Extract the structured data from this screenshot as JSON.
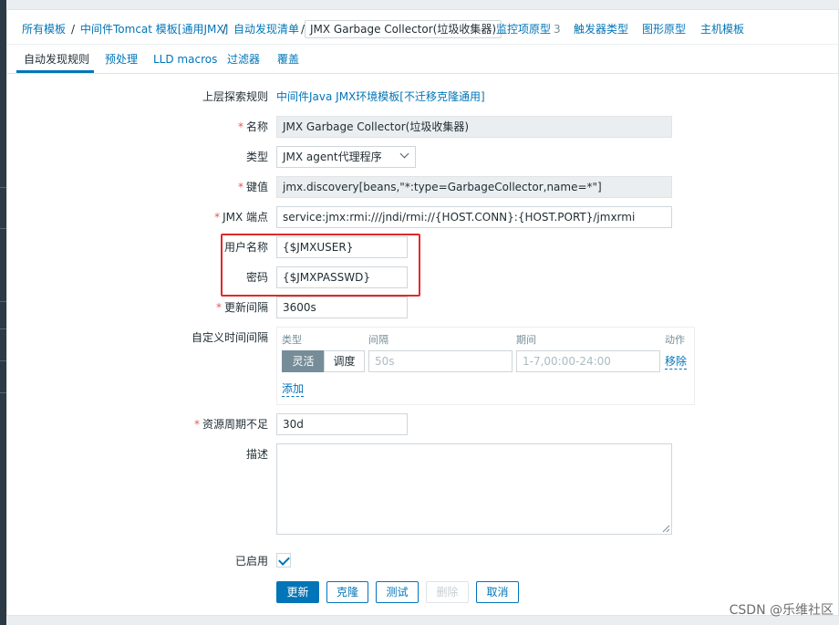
{
  "breadcrumbs": [
    {
      "label": "所有模板"
    },
    {
      "label": "中间件Tomcat 模板[通用JMX]"
    },
    {
      "label": "自动发现清单"
    },
    {
      "label": "JMX Garbage Collector(垃圾收集器)"
    },
    {
      "label": "监控项原型",
      "count": "3"
    },
    {
      "label": "触发器类型"
    },
    {
      "label": "图形原型"
    },
    {
      "label": "主机模板"
    }
  ],
  "tabs": [
    {
      "label": "自动发现规则",
      "active": true
    },
    {
      "label": "预处理"
    },
    {
      "label": "LLD macros"
    },
    {
      "label": "过滤器"
    },
    {
      "label": "覆盖"
    }
  ],
  "form": {
    "parent_rule": {
      "label": "上层探索规则",
      "value": "中间件Java JMX环境模板[不迁移克隆通用]"
    },
    "name": {
      "label": "名称",
      "value": "JMX Garbage Collector(垃圾收集器)"
    },
    "type": {
      "label": "类型",
      "value": "JMX agent代理程序"
    },
    "key": {
      "label": "键值",
      "value": "jmx.discovery[beans,\"*:type=GarbageCollector,name=*\"]"
    },
    "jmx_endpoint": {
      "label": "JMX 端点",
      "value": "service:jmx:rmi:///jndi/rmi://{HOST.CONN}:{HOST.PORT}/jmxrmi"
    },
    "username": {
      "label": "用户名称",
      "value": "{$JMXUSER}"
    },
    "password": {
      "label": "密码",
      "value": "{$JMXPASSWD}"
    },
    "update_interval": {
      "label": "更新间隔",
      "value": "3600s"
    },
    "custom_intervals": {
      "label": "自定义时间间隔",
      "headers": {
        "type": "类型",
        "interval": "间隔",
        "period": "期间",
        "action": "动作"
      },
      "seg_flexible": "灵活",
      "seg_scheduling": "调度",
      "interval_placeholder": "50s",
      "period_placeholder": "1-7,00:00-24:00",
      "remove": "移除",
      "add": "添加"
    },
    "keep_lost": {
      "label": "资源周期不足",
      "value": "30d"
    },
    "description": {
      "label": "描述",
      "value": ""
    },
    "enabled": {
      "label": "已启用",
      "checked": true
    }
  },
  "buttons": {
    "update": "更新",
    "clone": "克隆",
    "test": "测试",
    "delete": "删除",
    "cancel": "取消"
  },
  "watermark": "CSDN @乐维社区",
  "colors": {
    "link": "#0275b8",
    "required": "#e45959",
    "highlight_box": "#e02a2a"
  }
}
